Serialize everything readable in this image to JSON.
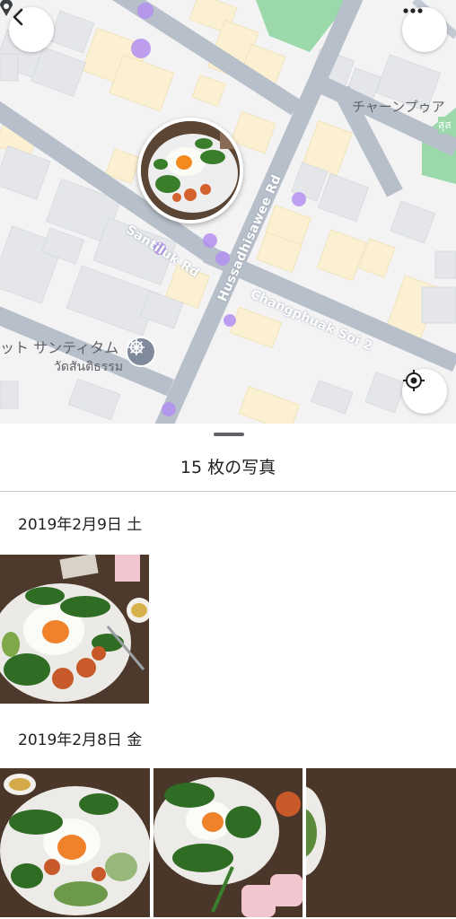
{
  "map": {
    "road_labels": {
      "santiluk": "Santiluk Rd",
      "hussadhisawee": "Hussadhisawee Rd",
      "changphuak": "Changphuak Soi 2"
    },
    "poi_labels": {
      "chan_phueak": "チャーンプゥア",
      "thai_fragment": "สุส",
      "santitham_jp": "ット サンティタム",
      "santitham_th": "วัดสันติธรรม"
    },
    "icons": {
      "back": "chevron-left-icon",
      "more": "more-horizontal-icon",
      "locate": "my-location-icon",
      "temple": "dharma-wheel-icon"
    }
  },
  "sheet": {
    "title": "15 枚の写真",
    "sections": [
      {
        "date": "2019年2月9日 土",
        "photo_count": 1
      },
      {
        "date": "2019年2月8日 金",
        "photo_count": 3
      }
    ]
  },
  "colors": {
    "road": "#aeb7c3",
    "park": "#8fd3a0",
    "building_yellow": "#fbf1d2",
    "building_gray": "#e4e6ea",
    "location_dot": "#b48ff0"
  }
}
